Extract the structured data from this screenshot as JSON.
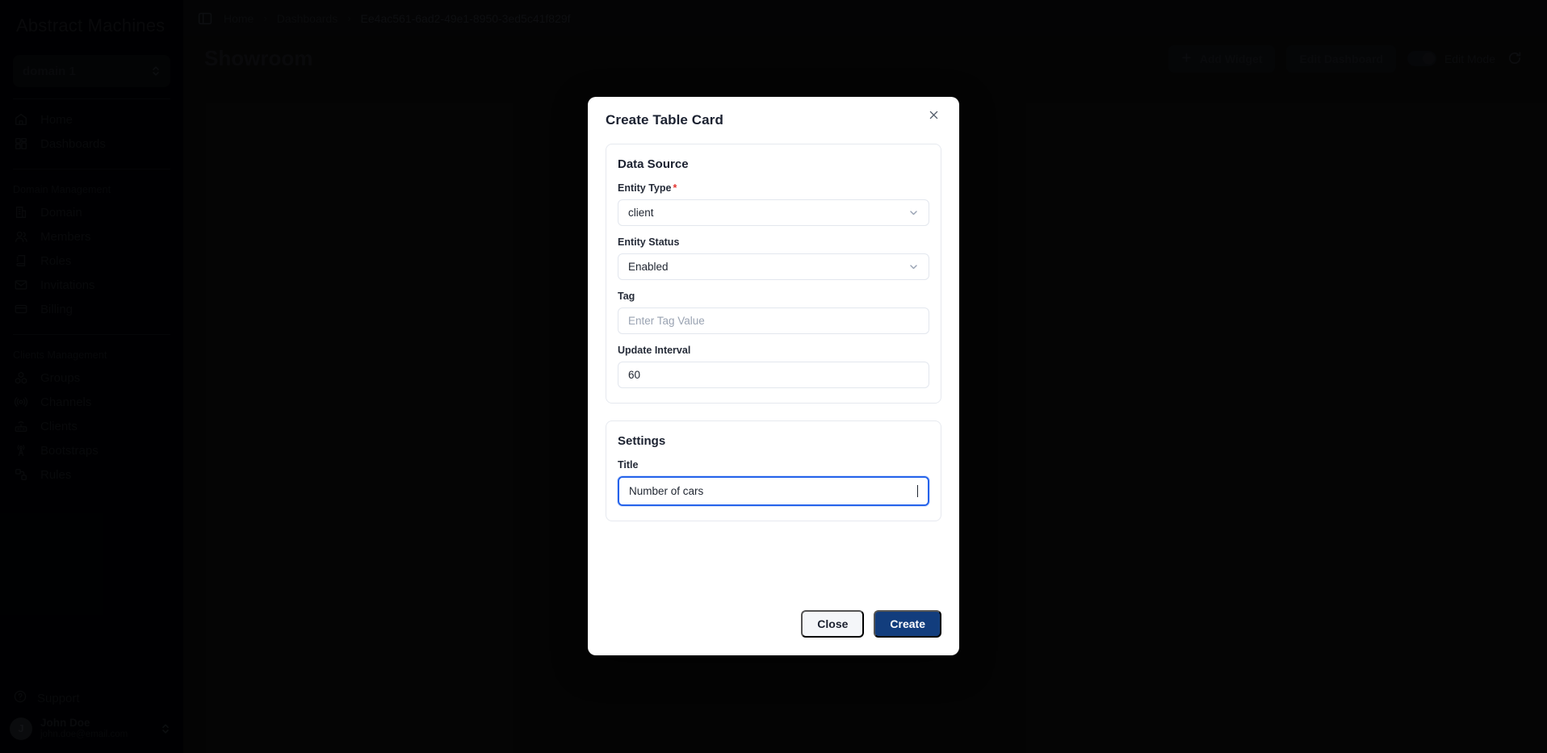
{
  "sidebar": {
    "brand": "Abstract Machines",
    "domain_selector": {
      "value": "domain 1",
      "icon": "chevron-up-down-icon"
    },
    "nav": [
      {
        "caption": null,
        "items": [
          {
            "label": "Home",
            "icon": "home-icon"
          },
          {
            "label": "Dashboards",
            "icon": "grid-icon"
          }
        ]
      },
      {
        "caption": "Domain Management",
        "items": [
          {
            "label": "Domain",
            "icon": "building-icon"
          },
          {
            "label": "Members",
            "icon": "users-icon"
          },
          {
            "label": "Roles",
            "icon": "book-icon"
          },
          {
            "label": "Invitations",
            "icon": "mail-icon"
          },
          {
            "label": "Billing",
            "icon": "credit-card-icon"
          }
        ]
      },
      {
        "caption": "Clients Management",
        "items": [
          {
            "label": "Groups",
            "icon": "cubes-icon"
          },
          {
            "label": "Channels",
            "icon": "broadcast-icon"
          },
          {
            "label": "Clients",
            "icon": "router-icon"
          },
          {
            "label": "Bootstraps",
            "icon": "antenna-icon"
          },
          {
            "label": "Rules",
            "icon": "nodes-icon"
          }
        ]
      }
    ],
    "support": {
      "label": "Support",
      "icon": "help-circle-icon"
    },
    "user": {
      "initial": "J",
      "name": "John Doe",
      "email": "john.doe@email.com",
      "icon": "chevron-up-down-icon"
    }
  },
  "topbar": {
    "panel_toggle_icon": "sidebar-panel-icon",
    "breadcrumbs": [
      "Home",
      "Dashboards",
      "Ee4ac561-6ad2-49e1-8950-3ed5c41f829f"
    ],
    "separator": "›"
  },
  "pagehead": {
    "title": "Showroom",
    "add_widget_label": "Add Widget",
    "add_widget_icon": "plus-icon",
    "edit_dashboard_label": "Edit Dashboard",
    "edit_mode_label": "Edit Mode",
    "edit_mode_on": true,
    "refresh_icon": "refresh-icon"
  },
  "modal": {
    "title": "Create Table Card",
    "close_icon": "close-icon",
    "data_source": {
      "title": "Data Source",
      "entity_type": {
        "label": "Entity Type",
        "required": true,
        "value": "client",
        "icon": "chevron-down-icon"
      },
      "entity_status": {
        "label": "Entity Status",
        "required": false,
        "value": "Enabled",
        "icon": "chevron-down-icon"
      },
      "tag": {
        "label": "Tag",
        "required": false,
        "value": "",
        "placeholder": "Enter Tag Value"
      },
      "update_interval": {
        "label": "Update Interval",
        "required": false,
        "value": "60"
      }
    },
    "settings": {
      "title": "Settings",
      "title_field": {
        "label": "Title",
        "value": "Number of cars",
        "focused": true
      }
    },
    "close_label": "Close",
    "create_label": "Create"
  },
  "colors": {
    "sidebar_bg": "#010205",
    "main_bg": "#0a0a0b",
    "modal_bg": "#ffffff",
    "primary": "#123d7d",
    "focus_border": "#2563eb",
    "required_asterisk": "#e3342f"
  }
}
